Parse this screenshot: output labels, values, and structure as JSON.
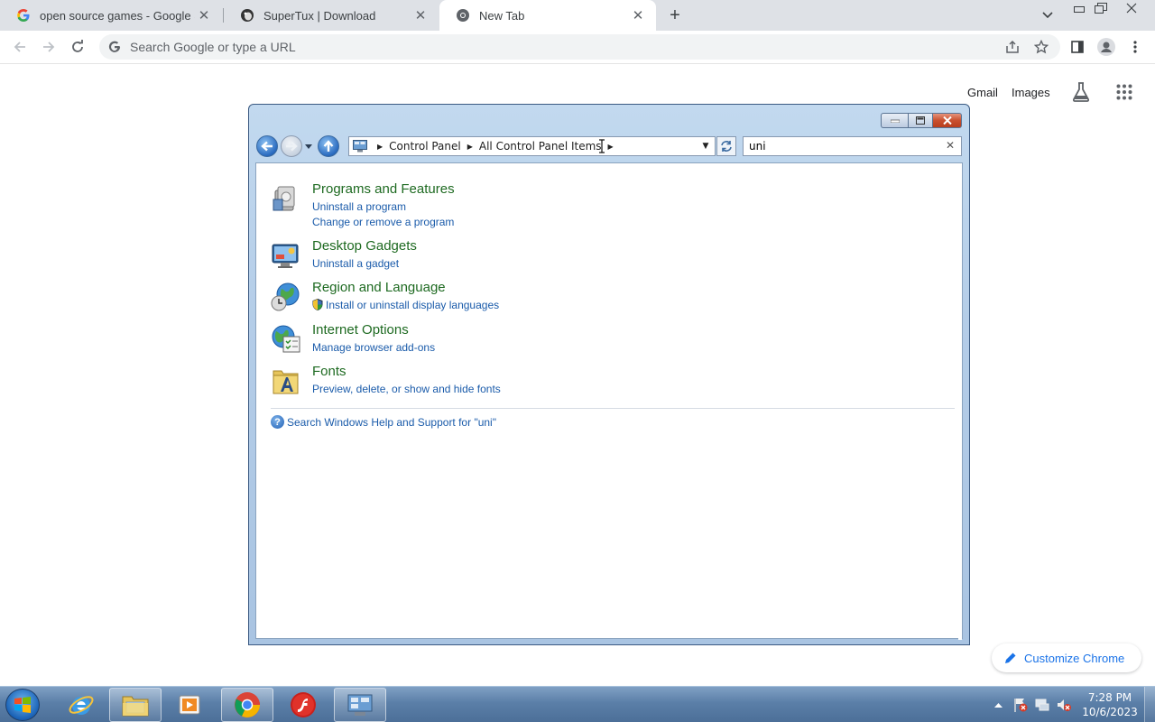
{
  "browser": {
    "tabs": [
      {
        "title": "open source games - Google Sea",
        "icon": "google-g-icon"
      },
      {
        "title": "SuperTux | Download",
        "icon": "supertux-icon"
      },
      {
        "title": "New Tab",
        "icon": "chrome-icon",
        "active": true
      }
    ],
    "omnibox_placeholder": "Search Google or type a URL"
  },
  "ntp": {
    "gmail": "Gmail",
    "images": "Images",
    "customize": "Customize Chrome"
  },
  "control_panel": {
    "breadcrumb": [
      "Control Panel",
      "All Control Panel Items"
    ],
    "search_value": "uni",
    "results": [
      {
        "title": "Programs and Features",
        "icon": "programs-features-icon",
        "links": [
          "Uninstall a program",
          "Change or remove a program"
        ]
      },
      {
        "title": "Desktop Gadgets",
        "icon": "desktop-gadgets-icon",
        "links": [
          "Uninstall a gadget"
        ]
      },
      {
        "title": "Region and Language",
        "icon": "region-language-icon",
        "links": [
          "Install or uninstall display languages"
        ]
      },
      {
        "title": "Internet Options",
        "icon": "internet-options-icon",
        "links": [
          "Manage browser add-ons"
        ]
      },
      {
        "title": "Fonts",
        "icon": "fonts-folder-icon",
        "links": [
          "Preview, delete, or show and hide fonts"
        ]
      }
    ],
    "help_link": "Search Windows Help and Support for \"uni\""
  },
  "taskbar": {
    "items": [
      "internet-explorer-icon",
      "windows-explorer-icon",
      "media-player-icon",
      "chrome-icon",
      "flash-icon",
      "control-panel-icon"
    ],
    "time": "7:28 PM",
    "date": "10/6/2023"
  }
}
